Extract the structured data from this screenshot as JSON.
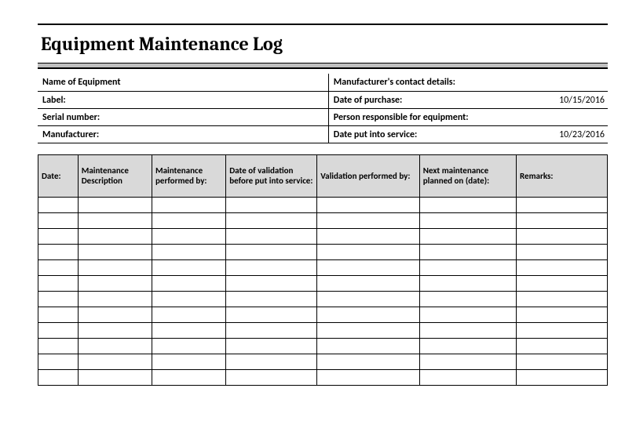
{
  "title": "Equipment Maintenance Log",
  "info": {
    "rows": [
      {
        "left_label": "Name of Equipment",
        "left_value": "",
        "right_label": "Manufacturer's contact details:",
        "right_value": ""
      },
      {
        "left_label": "Label:",
        "left_value": "",
        "right_label": "Date of purchase:",
        "right_value": "10/15/2016"
      },
      {
        "left_label": "Serial number:",
        "left_value": "",
        "right_label": "Person responsible for equipment:",
        "right_value": ""
      },
      {
        "left_label": "Manufacturer:",
        "left_value": "",
        "right_label": "Date put into service:",
        "right_value": "10/23/2016"
      }
    ]
  },
  "log": {
    "headers": [
      "Date:",
      "Maintenance Description",
      "Maintenance performed by:",
      "Date of validation before put into service:",
      "Validation performed by:",
      "Next maintenance planned on (date):",
      "Remarks:"
    ],
    "rows": [
      [
        "",
        "",
        "",
        "",
        "",
        "",
        ""
      ],
      [
        "",
        "",
        "",
        "",
        "",
        "",
        ""
      ],
      [
        "",
        "",
        "",
        "",
        "",
        "",
        ""
      ],
      [
        "",
        "",
        "",
        "",
        "",
        "",
        ""
      ],
      [
        "",
        "",
        "",
        "",
        "",
        "",
        ""
      ],
      [
        "",
        "",
        "",
        "",
        "",
        "",
        ""
      ],
      [
        "",
        "",
        "",
        "",
        "",
        "",
        ""
      ],
      [
        "",
        "",
        "",
        "",
        "",
        "",
        ""
      ],
      [
        "",
        "",
        "",
        "",
        "",
        "",
        ""
      ],
      [
        "",
        "",
        "",
        "",
        "",
        "",
        ""
      ],
      [
        "",
        "",
        "",
        "",
        "",
        "",
        ""
      ],
      [
        "",
        "",
        "",
        "",
        "",
        "",
        ""
      ]
    ]
  }
}
